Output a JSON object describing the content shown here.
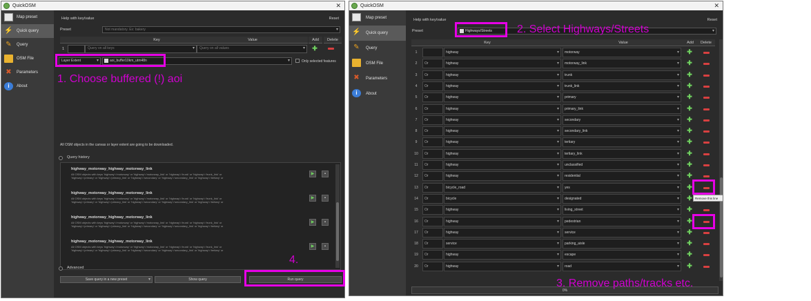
{
  "app_title": "QuickOSM",
  "close_glyph": "✕",
  "sidebar": {
    "items": [
      {
        "label": "Map preset",
        "icon": "map-icon"
      },
      {
        "label": "Quick query",
        "icon": "lightning-icon"
      },
      {
        "label": "Query",
        "icon": "pencil-icon"
      },
      {
        "label": "OSM File",
        "icon": "folder-icon"
      },
      {
        "label": "Parameters",
        "icon": "tools-icon"
      },
      {
        "label": "About",
        "icon": "info-icon"
      }
    ]
  },
  "left": {
    "help_link": "Help with key/value",
    "reset": "Reset",
    "preset_label": "Preset",
    "preset_placeholder": "Not mandatory. Ex: bakery",
    "table_headers": {
      "key": "Key",
      "value": "Value",
      "add": "Add",
      "delete": "Delete"
    },
    "row": {
      "num": "1",
      "key_placeholder": "Query on all keys",
      "value_placeholder": "Query on all values"
    },
    "extent_select": "Layer Extent",
    "layer_select": "aoi_buffer10km_utm48n",
    "only_selected": "Only selected features",
    "info_text": "All OSM objects in the canvas or layer extent are going to be downloaded.",
    "query_history_label": "Query history",
    "history": [
      {
        "title": "highway_motorway_highway_motorway_link",
        "desc1": "All OSM objects with keys 'highway'='motorway' or 'highway'='motorway_link' or 'highway'='trunk' or 'highway'='trunk_link' or",
        "desc2": "'highway'='primary' or 'highway'='primary_link' or 'highway'='secondary' or 'highway'='secondary_link' or 'highway'='tertiary' or"
      },
      {
        "title": "highway_motorway_highway_motorway_link",
        "desc1": "All OSM objects with keys 'highway'='motorway' or 'highway'='motorway_link' or 'highway'='trunk' or 'highway'='trunk_link' or",
        "desc2": "'highway'='primary' or 'highway'='primary_link' or 'highway'='secondary' or 'highway'='secondary_link' or 'highway'='tertiary' or"
      },
      {
        "title": "highway_motorway_highway_motorway_link",
        "desc1": "All OSM objects with keys 'highway'='motorway' or 'highway'='motorway_link' or 'highway'='trunk' or 'highway'='trunk_link' or",
        "desc2": "'highway'='primary' or 'highway'='primary_link' or 'highway'='secondary' or 'highway'='secondary_link' or 'highway'='tertiary' or"
      },
      {
        "title": "highway_motorway_highway_motorway_link",
        "desc1": "All OSM objects with keys 'highway'='motorway' or 'highway'='motorway_link' or 'highway'='trunk' or 'highway'='trunk_link' or",
        "desc2": "'highway'='primary' or 'highway'='primary_link' or 'highway'='secondary' or 'highway'='secondary_link' or 'highway'='tertiary' or"
      }
    ],
    "advanced_label": "Advanced",
    "save_query": "Save query in a new preset",
    "show_query": "Show query",
    "run_query": "Run query"
  },
  "right": {
    "help_link": "Help with key/value",
    "reset": "Reset",
    "preset_label": "Preset",
    "preset_value": "Highways/Streets",
    "table_headers": {
      "key": "Key",
      "value": "Value",
      "add": "Add",
      "delete": "Delete"
    },
    "rows": [
      {
        "num": "1",
        "op": "",
        "key": "highway",
        "value": "motorway"
      },
      {
        "num": "2",
        "op": "Or",
        "key": "highway",
        "value": "motorway_link"
      },
      {
        "num": "3",
        "op": "Or",
        "key": "highway",
        "value": "trunk"
      },
      {
        "num": "4",
        "op": "Or",
        "key": "highway",
        "value": "trunk_link"
      },
      {
        "num": "5",
        "op": "Or",
        "key": "highway",
        "value": "primary"
      },
      {
        "num": "6",
        "op": "Or",
        "key": "highway",
        "value": "primary_link"
      },
      {
        "num": "7",
        "op": "Or",
        "key": "highway",
        "value": "secondary"
      },
      {
        "num": "8",
        "op": "Or",
        "key": "highway",
        "value": "secondary_link"
      },
      {
        "num": "9",
        "op": "Or",
        "key": "highway",
        "value": "tertiary"
      },
      {
        "num": "10",
        "op": "Or",
        "key": "highway",
        "value": "tertiary_link"
      },
      {
        "num": "11",
        "op": "Or",
        "key": "highway",
        "value": "unclassified"
      },
      {
        "num": "12",
        "op": "Or",
        "key": "highway",
        "value": "residential"
      },
      {
        "num": "13",
        "op": "Or",
        "key": "bicycle_road",
        "value": "yes"
      },
      {
        "num": "14",
        "op": "Or",
        "key": "bicycle",
        "value": "designated"
      },
      {
        "num": "15",
        "op": "Or",
        "key": "highway",
        "value": "living_street"
      },
      {
        "num": "16",
        "op": "Or",
        "key": "highway",
        "value": "pedestrian"
      },
      {
        "num": "17",
        "op": "Or",
        "key": "highway",
        "value": "service"
      },
      {
        "num": "18",
        "op": "Or",
        "key": "service",
        "value": "parking_aisle"
      },
      {
        "num": "19",
        "op": "Or",
        "key": "highway",
        "value": "escape"
      },
      {
        "num": "20",
        "op": "Or",
        "key": "highway",
        "value": "road"
      }
    ],
    "tooltip": "Remove this line",
    "progress": "0%"
  },
  "annotations": {
    "step1": "1. Choose buffered (!) aoi",
    "step2": "2. Select Highways/Streets",
    "step3": "3. Remove paths/tracks etc.",
    "step4": "4."
  },
  "colors": {
    "annotation": "#e600e6",
    "panel_bg": "#2b2b2b",
    "sidebar_bg": "#3a3a3a",
    "add": "#6fcf5f",
    "delete": "#d84040"
  }
}
